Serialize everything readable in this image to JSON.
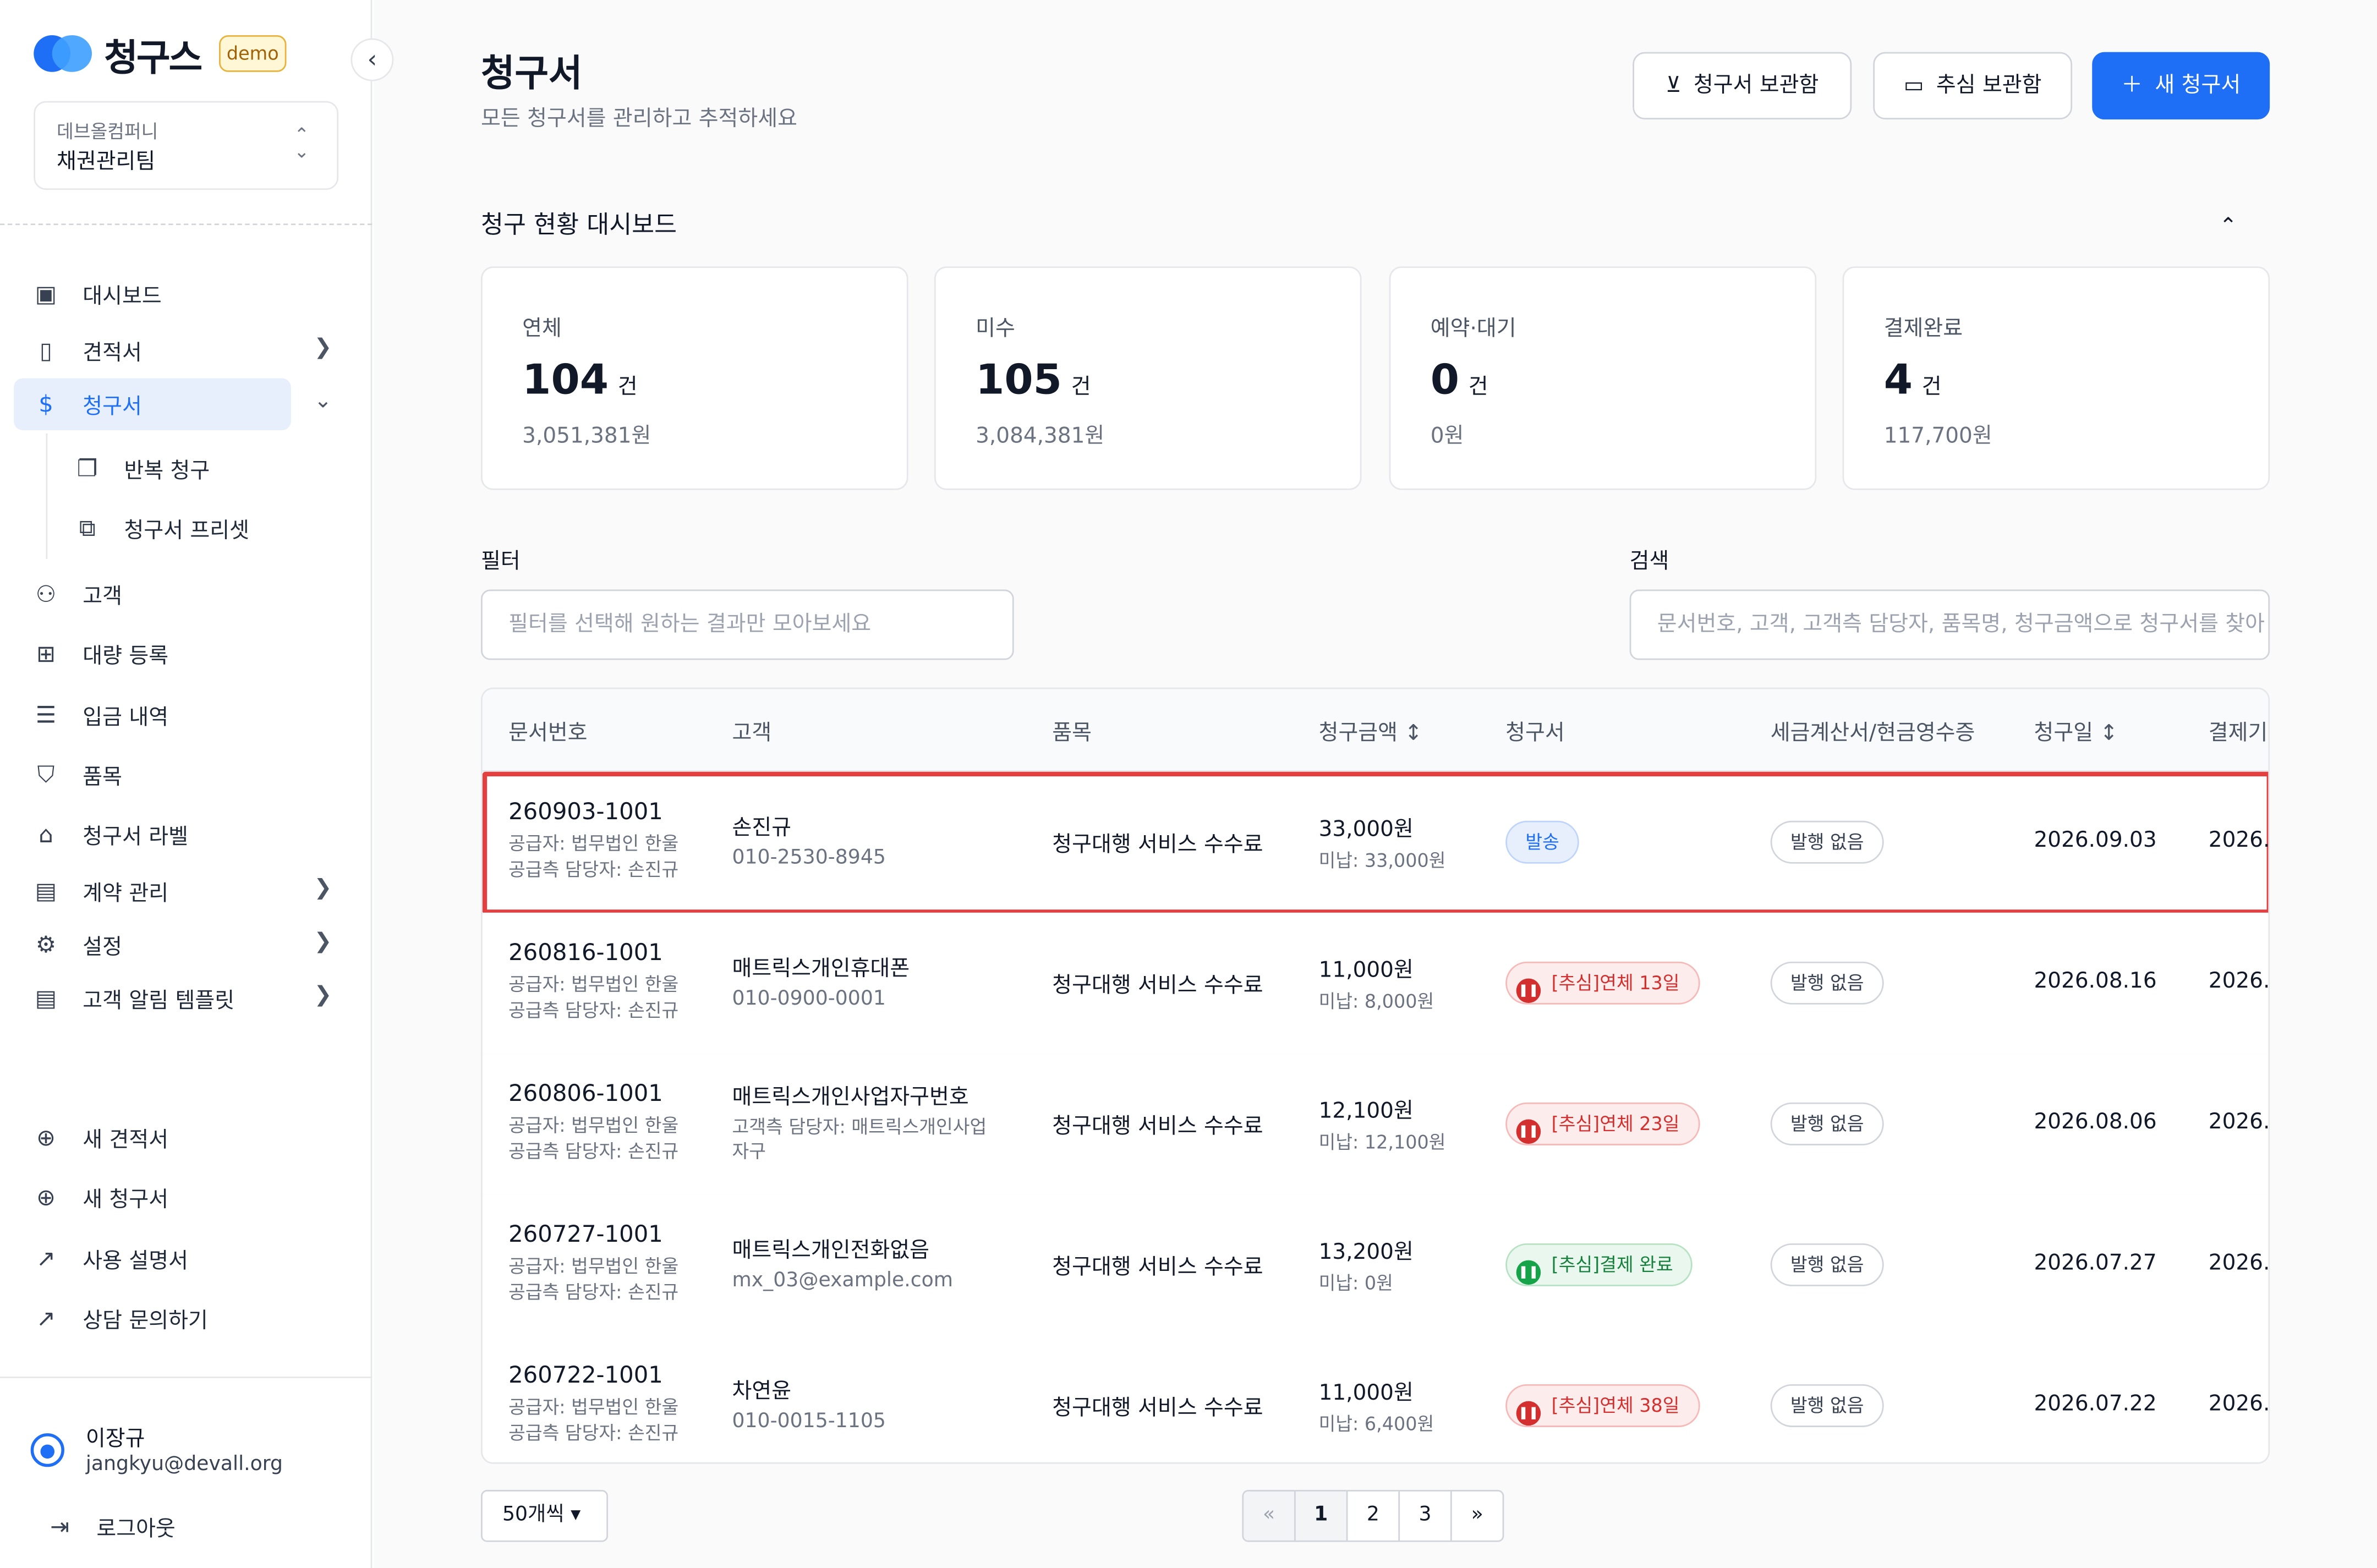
{
  "brand": {
    "name": "청구스",
    "badge": "demo"
  },
  "org": {
    "company": "데브올컴퍼니",
    "team": "채권관리팀"
  },
  "nav": [
    {
      "label": "대시보드",
      "icon": "presentation-icon"
    },
    {
      "label": "견적서",
      "icon": "quote-doc-icon"
    },
    {
      "label": "청구서",
      "icon": "invoice-icon"
    },
    {
      "label": "반복 청구",
      "icon": "recurring-icon"
    },
    {
      "label": "청구서 프리셋",
      "icon": "copy-icon"
    },
    {
      "label": "고객",
      "icon": "users-icon"
    },
    {
      "label": "대량 등록",
      "icon": "folder-plus-icon"
    },
    {
      "label": "입금 내역",
      "icon": "list-icon"
    },
    {
      "label": "품목",
      "icon": "bag-icon"
    },
    {
      "label": "청구서 라벨",
      "icon": "tag-icon"
    },
    {
      "label": "계약 관리",
      "icon": "contract-icon"
    },
    {
      "label": "설정",
      "icon": "gear-icon"
    },
    {
      "label": "고객 알림 템플릿",
      "icon": "template-icon"
    }
  ],
  "quick": [
    {
      "label": "새 견적서"
    },
    {
      "label": "새 청구서"
    },
    {
      "label": "사용 설명서"
    },
    {
      "label": "상담 문의하기"
    }
  ],
  "user": {
    "name": "이장규",
    "email": "jangkyu@devall.org",
    "logout": "로그아웃"
  },
  "page": {
    "title": "청구서",
    "subtitle": "모든 청구서를 관리하고 추적하세요"
  },
  "actions": {
    "archive": "청구서 보관함",
    "collection": "추심 보관함",
    "new": "새 청구서"
  },
  "dashboard": {
    "title": "청구 현황 대시보드",
    "cards": [
      {
        "label": "연체",
        "count": "104",
        "unit": "건",
        "amount": "3,051,381원"
      },
      {
        "label": "미수",
        "count": "105",
        "unit": "건",
        "amount": "3,084,381원"
      },
      {
        "label": "예약·대기",
        "count": "0",
        "unit": "건",
        "amount": "0원"
      },
      {
        "label": "결제완료",
        "count": "4",
        "unit": "건",
        "amount": "117,700원"
      }
    ]
  },
  "filter": {
    "label": "필터",
    "placeholder": "필터를 선택해 원하는 결과만 모아보세요"
  },
  "search": {
    "label": "검색",
    "placeholder": "문서번호, 고객, 고객측 담당자, 품목명, 청구금액으로 청구서를 찾아"
  },
  "table": {
    "headers": [
      "문서번호",
      "고객",
      "품목",
      "청구금액 ↕",
      "청구서",
      "세금계산서/현금영수증",
      "청구일 ↕",
      "결제기"
    ],
    "rows": [
      {
        "doc": "260903-1001",
        "sup1": "공급자: 법무법인 한울",
        "sup2": "공급측 담당자: 손진규",
        "cust": "손진규",
        "sub": "010-2530-8945",
        "item": "청구대행 서비스 수수료",
        "amount": "33,000원",
        "unpaid": "미납: 33,000원",
        "status": "발송",
        "tax": "발행 없음",
        "date": "2026.09.03",
        "pay": "2026."
      },
      {
        "doc": "260816-1001",
        "sup1": "공급자: 법무법인 한울",
        "sup2": "공급측 담당자: 손진규",
        "cust": "매트릭스개인휴대폰",
        "sub": "010-0900-0001",
        "item": "청구대행 서비스 수수료",
        "amount": "11,000원",
        "unpaid": "미납: 8,000원",
        "status": "[추심]연체 13일",
        "tax": "발행 없음",
        "date": "2026.08.16",
        "pay": "2026."
      },
      {
        "doc": "260806-1001",
        "sup1": "공급자: 법무법인 한울",
        "sup2": "공급측 담당자: 손진규",
        "cust": "매트릭스개인사업자구번호",
        "sub": "고객측 담당자: 매트릭스개인사업",
        "sub2": "자구",
        "item": "청구대행 서비스 수수료",
        "amount": "12,100원",
        "unpaid": "미납: 12,100원",
        "status": "[추심]연체 23일",
        "tax": "발행 없음",
        "date": "2026.08.06",
        "pay": "2026."
      },
      {
        "doc": "260727-1001",
        "sup1": "공급자: 법무법인 한울",
        "sup2": "공급측 담당자: 손진규",
        "cust": "매트릭스개인전화없음",
        "sub": "mx_03@example.com",
        "item": "청구대행 서비스 수수료",
        "amount": "13,200원",
        "unpaid": "미납: 0원",
        "status": "[추심]결제 완료",
        "tax": "발행 없음",
        "date": "2026.07.27",
        "pay": "2026."
      },
      {
        "doc": "260722-1001",
        "sup1": "공급자: 법무법인 한울",
        "sup2": "공급측 담당자: 손진규",
        "cust": "차연윤",
        "sub": "010-0015-1105",
        "item": "청구대행 서비스 수수료",
        "amount": "11,000원",
        "unpaid": "미납: 6,400원",
        "status": "[추심]연체 38일",
        "tax": "발행 없음",
        "date": "2026.07.22",
        "pay": "2026."
      }
    ]
  },
  "pagination": {
    "per_page": "50개씩 ▾",
    "prev": "«",
    "pages": [
      "1",
      "2",
      "3"
    ],
    "next": "»",
    "current": "1"
  },
  "colors": {
    "accent": "#1e6ff5",
    "danger": "#d32f2f",
    "success": "#16a34a",
    "highlight": "#e53e3e"
  }
}
